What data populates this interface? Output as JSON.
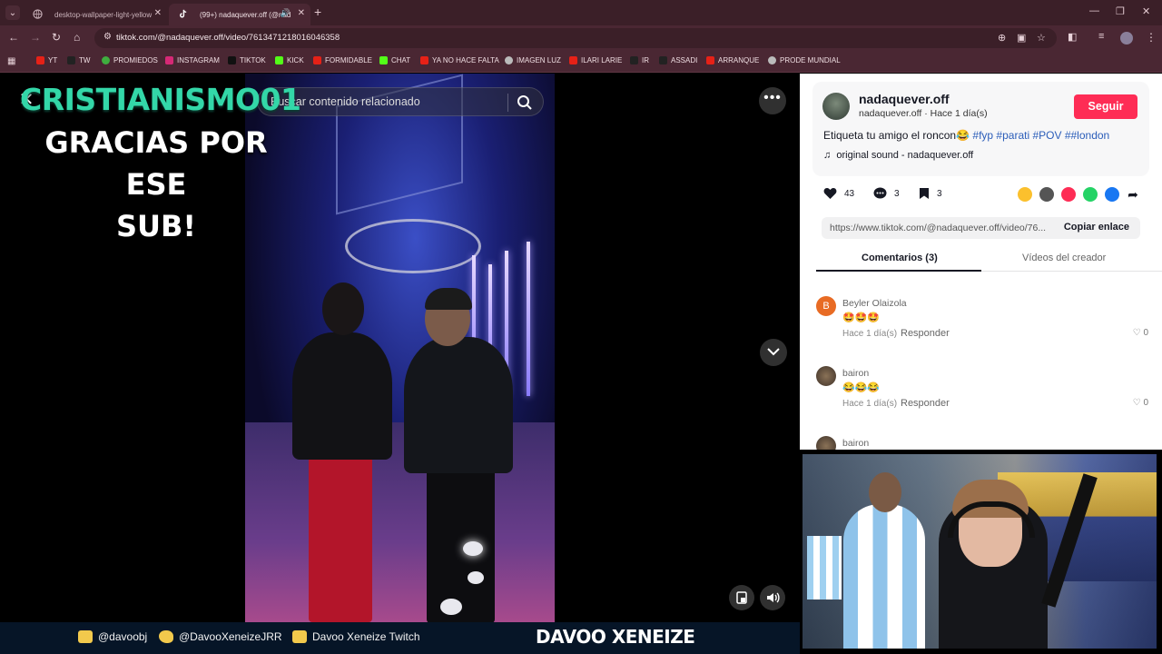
{
  "browser": {
    "tabs": [
      {
        "title": "desktop-wallpaper-light-yellow",
        "active": false
      },
      {
        "title": "(99+) nadaquever.off (@nad",
        "active": true
      }
    ],
    "url": "tiktok.com/@nadaquever.off/video/7613471218016046358",
    "bookmarks": [
      "YT",
      "TW",
      "PROMIEDOS",
      "INSTAGRAM",
      "TIKTOK",
      "KICK",
      "FORMIDABLE",
      "CHAT",
      "YA NO HACE FALTA",
      "IMAGEN LUZ",
      "ILARI LARIE",
      "IR",
      "ASSADI",
      "ARRANQUE",
      "PRODE MUNDIAL"
    ],
    "icons": [
      "tab-search-icon",
      "close-icon",
      "new-tab-icon",
      "back-icon",
      "forward-icon",
      "reload-icon",
      "home-icon",
      "zoom-icon",
      "cast-icon",
      "star-icon",
      "extensions-icon",
      "menu-icon"
    ]
  },
  "overlay": {
    "line1": "CRISTIANISMO01",
    "line2": "GRACIAS POR ESE",
    "line3": "SUB!",
    "color": "#33d7a8"
  },
  "video": {
    "search_placeholder": "Buscar contenido relacionado"
  },
  "post": {
    "username": "nadaquever.off",
    "meta": "nadaquever.off · Hace 1 día(s)",
    "follow_label": "Seguir",
    "follow_color": "#fe2c55",
    "caption_text": "Etiqueta tu amigo el roncon",
    "caption_emoji": "😂",
    "hashtags": [
      "#fyp",
      "#parati",
      "#POV",
      "##london"
    ],
    "sound": "original sound - nadaquever.off",
    "likes": "43",
    "comments": "3",
    "saves": "3",
    "link": "https://www.tiktok.com/@nadaquever.off/video/76...",
    "copy_label": "Copiar enlace"
  },
  "tabs": {
    "comments": "Comentarios (3)",
    "videos": "Vídeos del creador"
  },
  "comments": [
    {
      "user": "Beyler Olaizola",
      "text": "🤩🤩🤩",
      "time": "Hace 1 día(s)",
      "reply": "Responder",
      "likes": "0",
      "avatar_letter": "B",
      "avatar_color": "#e86b24"
    },
    {
      "user": "bairon",
      "text": "😂😂😂",
      "time": "Hace 1 día(s)",
      "reply": "Responder",
      "likes": "0",
      "avatar_letter": "",
      "avatar_color": "#6b5a45"
    },
    {
      "user": "bairon",
      "text": "",
      "time": "",
      "reply": "",
      "likes": "",
      "avatar_letter": "",
      "avatar_color": "#6b5a45"
    }
  ],
  "footer": {
    "instagram": "@davoobj",
    "twitter": "@DavooXeneizeJRR",
    "youtube": "Davoo Xeneize Twitch",
    "brand": "DAVOO XENEIZE"
  }
}
